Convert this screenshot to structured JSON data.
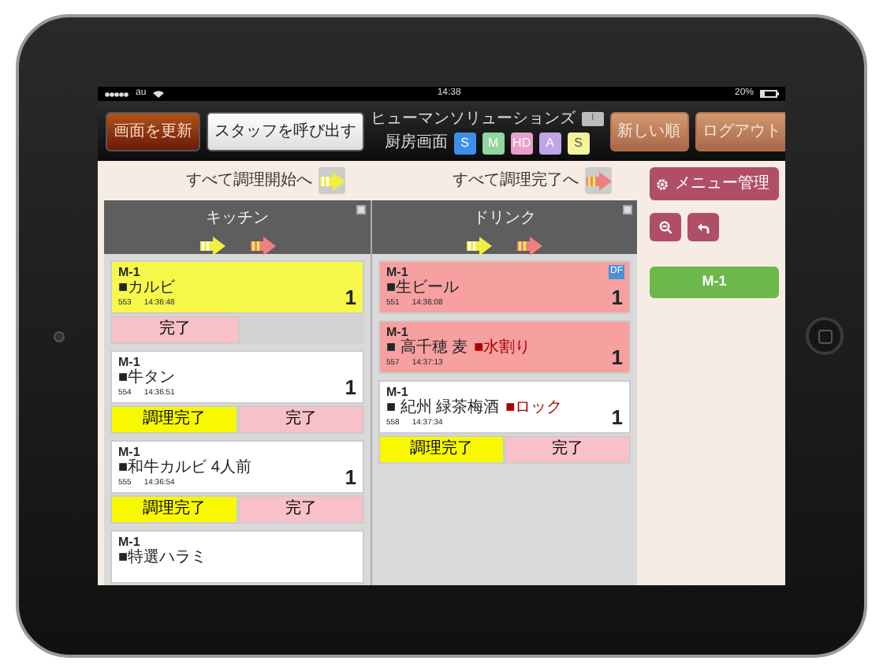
{
  "status_bar": {
    "carrier": "au",
    "time": "14:38",
    "battery": "20%"
  },
  "header": {
    "buttons_left": [
      {
        "label": "画面を更新",
        "kind": "dark"
      },
      {
        "label": "スタッフを呼び出す",
        "kind": "light"
      }
    ],
    "title": "ヒューマンソリューションズ",
    "handle": "I",
    "subtitle": "厨房画面",
    "filters": [
      {
        "label": "S",
        "color": "#3d8fe8"
      },
      {
        "label": "M",
        "color": "#8fd6a0"
      },
      {
        "label": "HD",
        "color": "#e8a0c8"
      },
      {
        "label": "A",
        "color": "#c0a4e8"
      },
      {
        "label": "S",
        "color": "#f4f49a"
      }
    ],
    "buttons_right": [
      "新しい順",
      "ログアウト"
    ]
  },
  "toolbar": [
    {
      "label": "すべて調理開始へ",
      "kind": "start"
    },
    {
      "label": "すべて調理完了へ",
      "kind": "finish"
    }
  ],
  "columns": [
    {
      "title": "キッチン",
      "orders": [
        {
          "table": "M-1",
          "item": "■カルビ",
          "seq": "553",
          "time": "14:36:48",
          "qty": "1",
          "color": "#f8f84a",
          "actions": [
            {
              "label": "完了",
              "kind": "done"
            }
          ]
        },
        {
          "table": "M-1",
          "item": "■牛タン",
          "seq": "554",
          "time": "14:36:51",
          "qty": "1",
          "color": "#ffffff",
          "actions": [
            {
              "label": "調理完了",
              "kind": "cook"
            },
            {
              "label": "完了",
              "kind": "done"
            }
          ]
        },
        {
          "table": "M-1",
          "item": "■和牛カルビ 4人前",
          "seq": "555",
          "time": "14:36:54",
          "qty": "1",
          "color": "#ffffff",
          "actions": [
            {
              "label": "調理完了",
              "kind": "cook"
            },
            {
              "label": "完了",
              "kind": "done"
            }
          ]
        },
        {
          "table": "M-1",
          "item": "■特選ハラミ",
          "color": "#ffffff"
        }
      ],
      "checked": false
    },
    {
      "title": "ドリンク",
      "orders": [
        {
          "table": "M-1",
          "item": "■生ビール",
          "seq": "551",
          "time": "14:36:08",
          "qty": "1",
          "color": "#f6a0a0",
          "badge": "DF"
        },
        {
          "table": "M-1",
          "item": "■ 高千穂 麦",
          "option": "■水割り",
          "seq": "557",
          "time": "14:37:13",
          "qty": "1",
          "color": "#f6a0a0"
        },
        {
          "table": "M-1",
          "item": "■ 紀州 緑茶梅酒",
          "option": "■ロック",
          "seq": "558",
          "time": "14:37:34",
          "qty": "1",
          "color": "#ffffff",
          "actions": [
            {
              "label": "調理完了",
              "kind": "cook"
            },
            {
              "label": "完了",
              "kind": "done"
            }
          ]
        }
      ],
      "checked": false
    }
  ],
  "side": {
    "menu_button": "メニュー管理",
    "order_button": "M-1"
  }
}
